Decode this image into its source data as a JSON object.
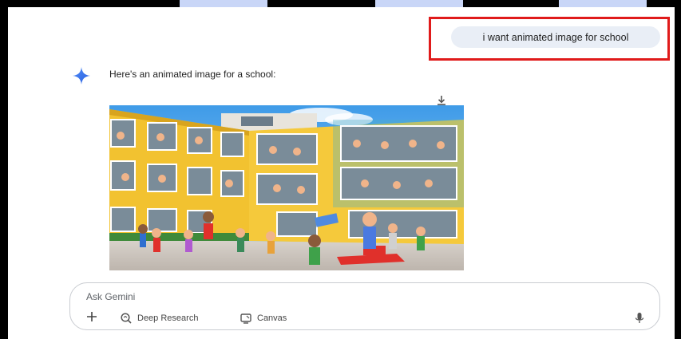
{
  "user_message": "i want animated image for school",
  "response": {
    "text": "Here's an animated image for a school:"
  },
  "input": {
    "placeholder": "Ask Gemini",
    "tools": [
      "Deep Research",
      "Canvas"
    ]
  },
  "colors": {
    "accent": "#4285f4",
    "highlight": "#e01b1b",
    "bubble": "#e9eef6"
  },
  "icons": [
    "sparkle-icon",
    "download-icon",
    "plus-icon",
    "deep-research-icon",
    "canvas-icon",
    "mic-icon"
  ]
}
